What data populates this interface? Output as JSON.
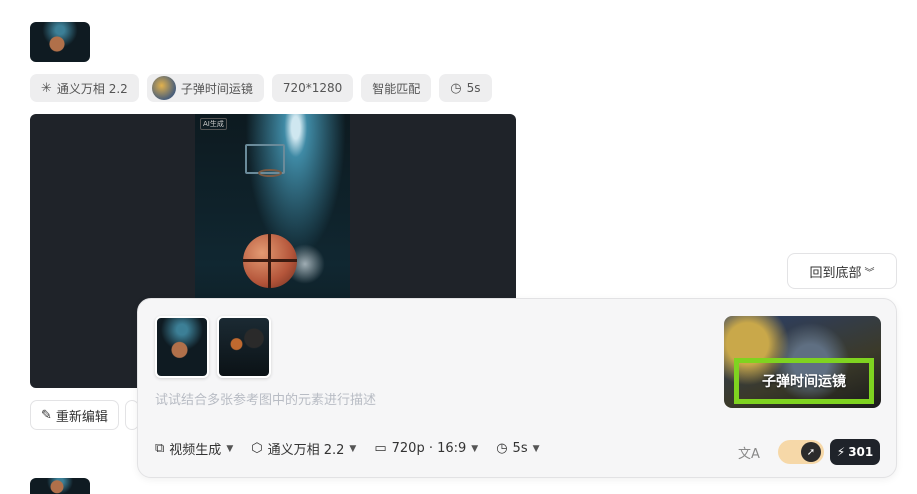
{
  "tags": [
    {
      "label": "通义万相 2.2",
      "icon": "model-icon"
    },
    {
      "label": "子弹时间运镜",
      "icon": "avatar"
    },
    {
      "label": "720*1280"
    },
    {
      "label": "智能匹配"
    },
    {
      "label": "5s",
      "icon": "clock-icon"
    }
  ],
  "player": {
    "badge": "AI生成"
  },
  "actions": {
    "re_edit": "重新编辑"
  },
  "back_to_bottom": "回到底部",
  "composer": {
    "placeholder": "试试结合多张参考图中的元素进行描述",
    "preset_label": "子弹时间运镜",
    "toolbar": {
      "mode": "视频生成",
      "model": "通义万相 2.2",
      "resolution": "720p · 16:9",
      "duration": "5s"
    },
    "credits": "301"
  },
  "colors": {
    "accent_green": "#7fd320",
    "submit_bg": "#1f232a",
    "toggle_bg": "#f6d8a8"
  }
}
